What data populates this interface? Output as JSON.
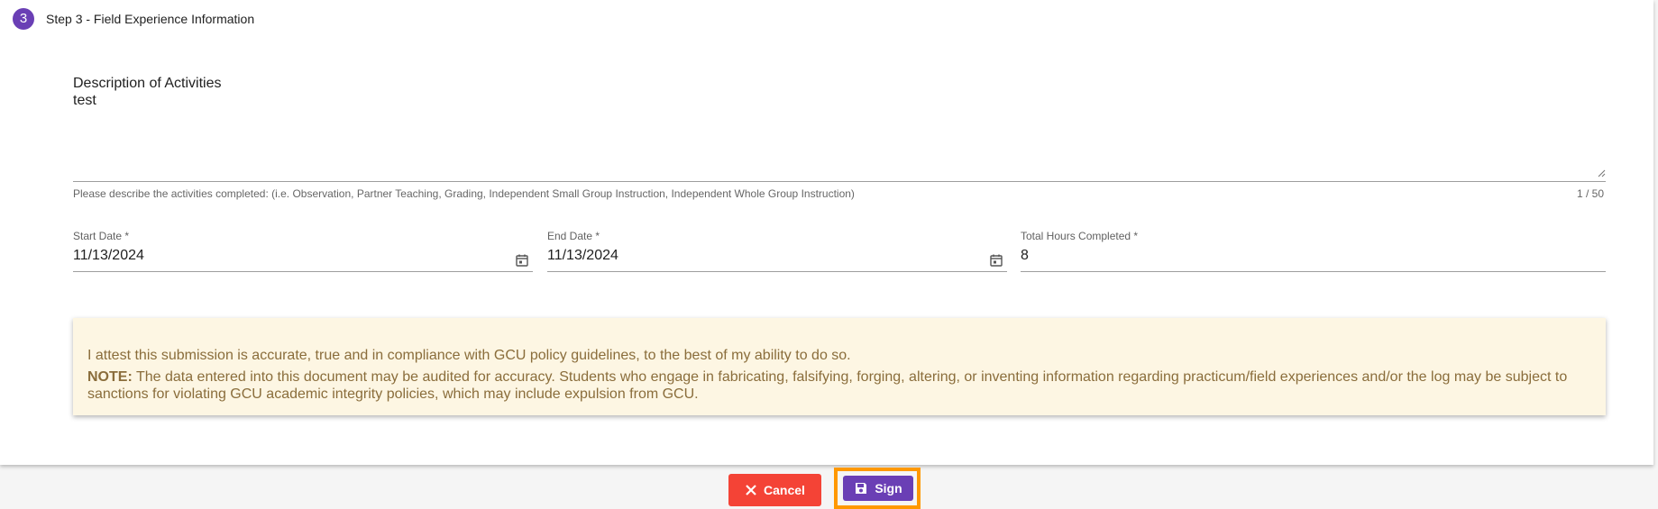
{
  "step": {
    "number": "3",
    "title": "Step 3 - Field Experience Information"
  },
  "description": {
    "label": "Description of Activities",
    "value": "test",
    "hint": "Please describe the activities completed: (i.e. Observation, Partner Teaching, Grading, Independent Small Group Instruction, Independent Whole Group Instruction)",
    "counter": "1 / 50"
  },
  "start_date": {
    "label": "Start Date *",
    "value": "11/13/2024"
  },
  "end_date": {
    "label": "End Date *",
    "value": "11/13/2024"
  },
  "total_hours": {
    "label": "Total Hours Completed *",
    "value": "8"
  },
  "notice": {
    "attest": "I attest this submission is accurate, true and in compliance with GCU policy guidelines, to the best of my ability to do so.",
    "note_label": "NOTE:",
    "note_text": " The data entered into this document may be audited for accuracy. Students who engage in fabricating, falsifying, forging, altering, or inventing information regarding practicum/field experiences and/or the log may be subject to sanctions for violating GCU academic integrity policies, which may include expulsion from GCU."
  },
  "actions": {
    "cancel_label": "Cancel",
    "sign_label": "Sign"
  },
  "icons": {
    "cancel": "close-icon",
    "sign": "save-icon",
    "date": "calendar-icon"
  },
  "colors": {
    "primary": "#6a3fb5",
    "cancel": "#f44336",
    "focus_outline": "#ff9800",
    "notice_bg": "#fdf6e3",
    "notice_text": "#8a6d3b"
  }
}
